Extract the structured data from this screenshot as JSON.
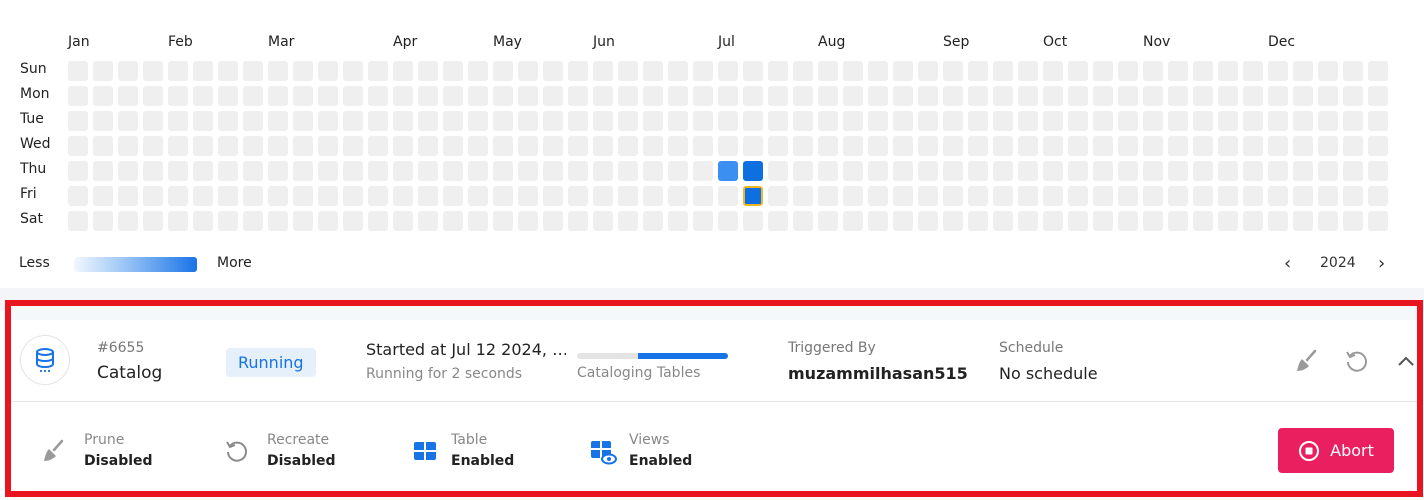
{
  "heatmap": {
    "months": [
      "Jan",
      "Feb",
      "Mar",
      "Apr",
      "May",
      "Jun",
      "Jul",
      "Aug",
      "Sep",
      "Oct",
      "Nov",
      "Dec"
    ],
    "days": [
      "Sun",
      "Mon",
      "Tue",
      "Wed",
      "Thu",
      "Fri",
      "Sat"
    ],
    "weeks": 53,
    "active": [
      {
        "week": 26,
        "day": 4,
        "level": 1
      },
      {
        "week": 27,
        "day": 4,
        "level": 2
      },
      {
        "week": 27,
        "day": 5,
        "level": 2,
        "highlighted": true
      }
    ],
    "legend": {
      "less": "Less",
      "more": "More"
    },
    "year": "2024"
  },
  "run": {
    "id": "#6655",
    "type": "Catalog",
    "status": "Running",
    "started": "Started at Jul 12 2024, …",
    "running_for": "Running for 2 seconds",
    "progress_label": "Cataloging Tables",
    "progress": {
      "start": 0.405,
      "end": 1.0
    },
    "triggered_by_label": "Triggered By",
    "triggered_by": "muzammilhasan515…",
    "schedule_label": "Schedule",
    "schedule": "No schedule"
  },
  "options": [
    {
      "label": "Prune",
      "value": "Disabled"
    },
    {
      "label": "Recreate",
      "value": "Disabled"
    },
    {
      "label": "Table",
      "value": "Enabled"
    },
    {
      "label": "Views",
      "value": "Enabled"
    }
  ],
  "abort_label": "Abort",
  "colors": {
    "accent": "#1773e6",
    "abort": "#ea1f5f",
    "frame": "#e8141f",
    "highlight": "#f1b52b"
  }
}
